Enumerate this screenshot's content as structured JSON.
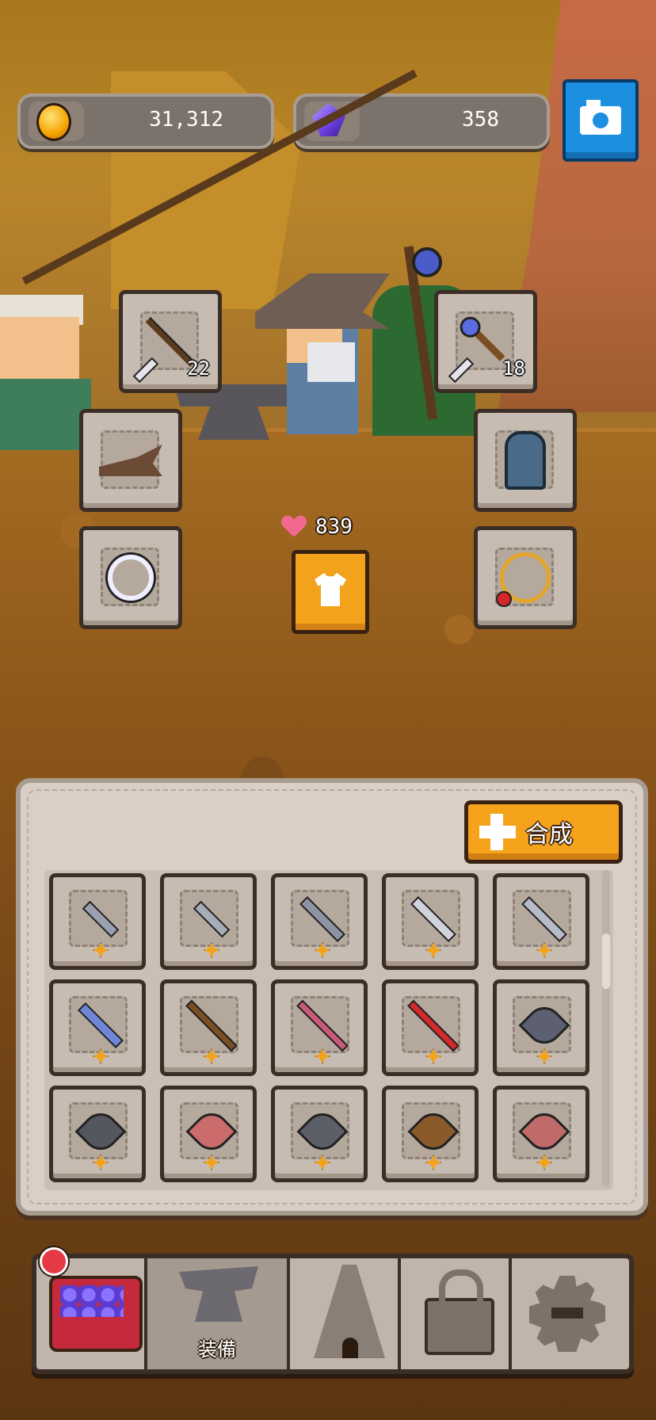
{
  "currency": {
    "gold": "31,312",
    "gems": "358",
    "gold_icon": "gold-coin-icon",
    "gem_icon": "purple-gem-icon"
  },
  "camera_icon": "camera-icon",
  "equipment": {
    "weapon_left": {
      "icon": "spear-icon",
      "count": "22"
    },
    "weapon_right": {
      "icon": "staff-icon",
      "count": "18"
    },
    "hat": {
      "icon": "hat-icon"
    },
    "cloak": {
      "icon": "cloak-icon"
    },
    "ring": {
      "icon": "ring-icon"
    },
    "amulet": {
      "icon": "amulet-icon"
    }
  },
  "stats": {
    "hp": "839"
  },
  "armor_button_icon": "shirt-icon",
  "inventory": {
    "merge_label": "合成",
    "items": [
      {
        "type": "dagger",
        "color": "#9aa0b0"
      },
      {
        "type": "dagger",
        "color": "#a8acb8"
      },
      {
        "type": "sword",
        "color": "#8d93a3"
      },
      {
        "type": "sword",
        "color": "#d0d3da"
      },
      {
        "type": "sword",
        "color": "#b8bcc8"
      },
      {
        "type": "sword",
        "color": "#6f86d6"
      },
      {
        "type": "spear",
        "color": "#7a5023"
      },
      {
        "type": "trident",
        "color": "#c95a7a"
      },
      {
        "type": "spear",
        "color": "#d62a2a"
      },
      {
        "type": "axe",
        "color": "#5c6070"
      },
      {
        "type": "axe",
        "color": "#55575e"
      },
      {
        "type": "axe",
        "color": "#cc6b6b"
      },
      {
        "type": "hammer",
        "color": "#5c5e68"
      },
      {
        "type": "club",
        "color": "#8a5a2a"
      },
      {
        "type": "club",
        "color": "#c06a6a"
      }
    ]
  },
  "nav": {
    "tabs": [
      {
        "icon": "treasure-chest-icon",
        "label": "",
        "has_alert": true
      },
      {
        "icon": "anvil-icon",
        "label": "装備",
        "active": true
      },
      {
        "icon": "tower-icon",
        "label": ""
      },
      {
        "icon": "lock-icon",
        "label": ""
      },
      {
        "icon": "gear-icon",
        "label": ""
      }
    ]
  }
}
